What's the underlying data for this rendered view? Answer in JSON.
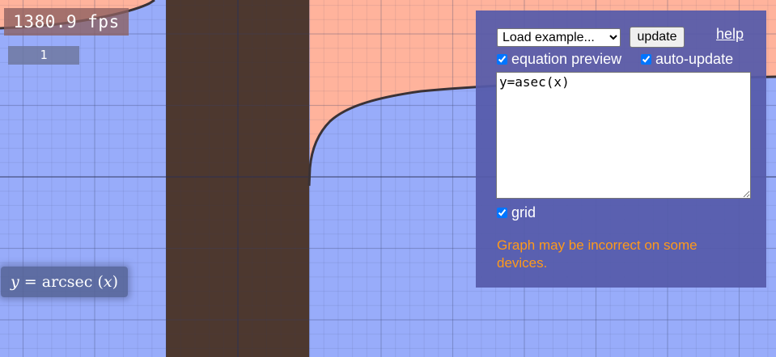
{
  "overlay": {
    "fps": "1380.9 fps",
    "frame_count": "1"
  },
  "graph": {
    "equation": "y = arcsec (x)",
    "equation_lhs": "y",
    "equation_func": "arcsec",
    "equation_arg": "x",
    "colors": {
      "below": "#98acfa",
      "above": "#ffb39c",
      "undefined": "#4d382f",
      "curve": "#3a3236"
    },
    "grid": true
  },
  "panel": {
    "example_select": {
      "value": "Load example...",
      "options": [
        "Load example..."
      ]
    },
    "update_label": "update",
    "help_label": "help",
    "equation_preview_label": "equation preview",
    "equation_preview_checked": true,
    "auto_update_label": "auto-update",
    "auto_update_checked": true,
    "equation_text": "y=asec(x)",
    "grid_label": "grid",
    "grid_checked": true,
    "warning": "Graph may be incorrect on some devices."
  }
}
